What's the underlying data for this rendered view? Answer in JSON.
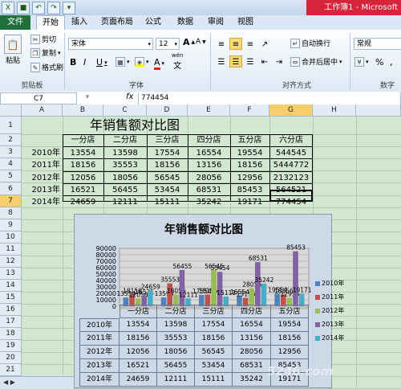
{
  "window": {
    "title": "工作簿1 - Microsoft"
  },
  "ribbon_tabs": [
    {
      "label": "文件",
      "id": "file"
    },
    {
      "label": "开始",
      "id": "home"
    },
    {
      "label": "插入",
      "id": "insert"
    },
    {
      "label": "页面布局",
      "id": "pagelayout"
    },
    {
      "label": "公式",
      "id": "formulas"
    },
    {
      "label": "数据",
      "id": "data"
    },
    {
      "label": "审阅",
      "id": "review"
    },
    {
      "label": "视图",
      "id": "view"
    }
  ],
  "clipboard": {
    "paste": "粘贴",
    "cut": "剪切",
    "copy": "复制",
    "format_painter": "格式刷",
    "group": "剪贴板"
  },
  "font": {
    "name": "宋体",
    "size": "12",
    "bold": "B",
    "italic": "I",
    "underline": "U",
    "grow": "A",
    "shrink": "A",
    "font_color_letter": "A",
    "wen": "wén",
    "wen_char": "文",
    "group": "字体"
  },
  "alignment": {
    "wrap_text": "自动换行",
    "merge_center": "合并后居中",
    "group": "对齐方式"
  },
  "number": {
    "format": "常规",
    "percent": "%",
    "comma": ",",
    "group": "数字"
  },
  "formula_bar": {
    "cell_ref": "C7",
    "fx": "fx",
    "value": "774454"
  },
  "columns": [
    "A",
    "B",
    "C",
    "D",
    "E",
    "F",
    "G",
    "H"
  ],
  "rows": [
    "1",
    "2",
    "3",
    "4",
    "5",
    "6",
    "7",
    "8",
    "9",
    "10",
    "11",
    "12",
    "13",
    "14",
    "15",
    "16",
    "17",
    "18",
    "19",
    "20",
    "21",
    "22"
  ],
  "sheet": {
    "title": "年销售额对比图",
    "headers": [
      "一分店",
      "二分店",
      "三分店",
      "四分店",
      "五分店",
      "六分店"
    ],
    "data": [
      {
        "year": "2010年",
        "values": [
          "13554",
          "13598",
          "17554",
          "16554",
          "19554",
          "544545"
        ]
      },
      {
        "year": "2011年",
        "values": [
          "18156",
          "35553",
          "18156",
          "13156",
          "18156",
          "5444772"
        ]
      },
      {
        "year": "2012年",
        "values": [
          "12056",
          "18056",
          "56545",
          "28056",
          "12956",
          "2132123"
        ]
      },
      {
        "year": "2013年",
        "values": [
          "16521",
          "56455",
          "53454",
          "68531",
          "85453",
          "564521"
        ]
      },
      {
        "year": "2014年",
        "values": [
          "24659",
          "12111",
          "15111",
          "35242",
          "19171",
          "774454"
        ]
      }
    ]
  },
  "chart_data": {
    "type": "bar",
    "title": "年销售额对比图",
    "categories": [
      "一分店",
      "二分店",
      "三分店",
      "四分店",
      "五分店"
    ],
    "series": [
      {
        "name": "2010年",
        "values": [
          13554,
          13598,
          17554,
          16554,
          19554
        ],
        "color": "#4f81bd"
      },
      {
        "name": "2011年",
        "values": [
          18156,
          35553,
          18156,
          13156,
          18156
        ],
        "color": "#c0504d"
      },
      {
        "name": "2012年",
        "values": [
          12056,
          18056,
          56545,
          28056,
          12956
        ],
        "color": "#9bbb59"
      },
      {
        "name": "2013年",
        "values": [
          16521,
          56455,
          53454,
          68531,
          85453
        ],
        "color": "#8064a2"
      },
      {
        "name": "2014年",
        "values": [
          24659,
          12111,
          15111,
          35242,
          19171
        ],
        "color": "#4bacc6"
      }
    ],
    "yticks": [
      "90000",
      "80000",
      "70000",
      "60000",
      "50000",
      "40000",
      "30000",
      "20000",
      "10000",
      "0"
    ],
    "ylim": [
      0,
      90000
    ],
    "legend_position": "right",
    "data_table": true,
    "data_labels_visible": [
      "13554",
      "24659",
      "56455",
      "35553",
      "13598",
      "12111",
      "56545",
      "53454",
      "28056",
      "68531",
      "35242",
      "85453",
      "19554",
      "12956",
      "19171",
      "16554",
      "18156",
      "13156",
      "17554"
    ]
  },
  "watermark": "5246.com"
}
